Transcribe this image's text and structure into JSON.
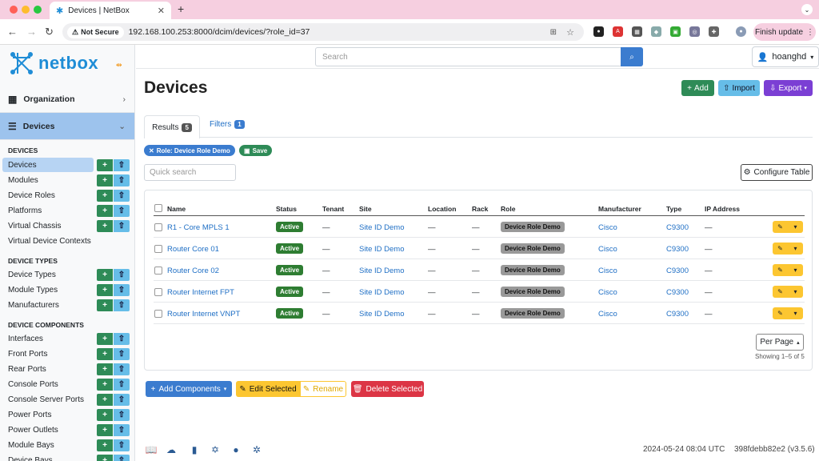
{
  "browser": {
    "tab_title": "Devices | NetBox",
    "security_label": "Not Secure",
    "url": "192.168.100.253:8000/dcim/devices/?role_id=37",
    "finish_update": "Finish update"
  },
  "sidebar": {
    "brand": "netbox",
    "sections": [
      {
        "label": "Organization",
        "icon": "building-icon"
      },
      {
        "label": "Devices",
        "icon": "server-icon"
      }
    ],
    "groups": [
      {
        "title": "DEVICES",
        "items": [
          "Devices",
          "Modules",
          "Device Roles",
          "Platforms",
          "Virtual Chassis",
          "Virtual Device Contexts"
        ]
      },
      {
        "title": "DEVICE TYPES",
        "items": [
          "Device Types",
          "Module Types",
          "Manufacturers"
        ]
      },
      {
        "title": "DEVICE COMPONENTS",
        "items": [
          "Interfaces",
          "Front Ports",
          "Rear Ports",
          "Console Ports",
          "Console Server Ports",
          "Power Ports",
          "Power Outlets",
          "Module Bays",
          "Device Bays"
        ]
      }
    ]
  },
  "topbar": {
    "search_placeholder": "Search",
    "user": "hoanghd"
  },
  "page": {
    "title": "Devices",
    "add": "Add",
    "import": "Import",
    "export": "Export"
  },
  "tabs": {
    "results": "Results",
    "results_count": "5",
    "filters": "Filters",
    "filters_count": "1"
  },
  "filter_chip": "Role: Device Role Demo",
  "save_chip": "Save",
  "quick_search_placeholder": "Quick search",
  "configure_table": "Configure Table",
  "table": {
    "headers": [
      "Name",
      "Status",
      "Tenant",
      "Site",
      "Location",
      "Rack",
      "Role",
      "Manufacturer",
      "Type",
      "IP Address"
    ],
    "rows": [
      {
        "name": "R1 - Core MPLS 1",
        "status": "Active",
        "tenant": "—",
        "site": "Site ID Demo",
        "location": "—",
        "rack": "—",
        "role": "Device Role Demo",
        "manufacturer": "Cisco",
        "type": "C9300",
        "ip": "—"
      },
      {
        "name": "Router Core 01",
        "status": "Active",
        "tenant": "—",
        "site": "Site ID Demo",
        "location": "—",
        "rack": "—",
        "role": "Device Role Demo",
        "manufacturer": "Cisco",
        "type": "C9300",
        "ip": "—"
      },
      {
        "name": "Router Core 02",
        "status": "Active",
        "tenant": "—",
        "site": "Site ID Demo",
        "location": "—",
        "rack": "—",
        "role": "Device Role Demo",
        "manufacturer": "Cisco",
        "type": "C9300",
        "ip": "—"
      },
      {
        "name": "Router Internet FPT",
        "status": "Active",
        "tenant": "—",
        "site": "Site ID Demo",
        "location": "—",
        "rack": "—",
        "role": "Device Role Demo",
        "manufacturer": "Cisco",
        "type": "C9300",
        "ip": "—"
      },
      {
        "name": "Router Internet VNPT",
        "status": "Active",
        "tenant": "—",
        "site": "Site ID Demo",
        "location": "—",
        "rack": "—",
        "role": "Device Role Demo",
        "manufacturer": "Cisco",
        "type": "C9300",
        "ip": "—"
      }
    ]
  },
  "per_page": "Per Page",
  "showing": "Showing 1–5 of 5",
  "bulk": {
    "add_components": "Add Components",
    "edit_selected": "Edit Selected",
    "rename": "Rename",
    "delete_selected": "Delete Selected"
  },
  "footer": {
    "timestamp": "2024-05-24 08:04 UTC",
    "version": "398fdebb82e2 (v3.5.6)"
  },
  "colors": {
    "green": "#2e8b57",
    "cyan": "#66bde8",
    "purple": "#7b3fd4",
    "red": "#dc3545",
    "yellow": "#fcc631",
    "blue": "#3b7ccf"
  }
}
